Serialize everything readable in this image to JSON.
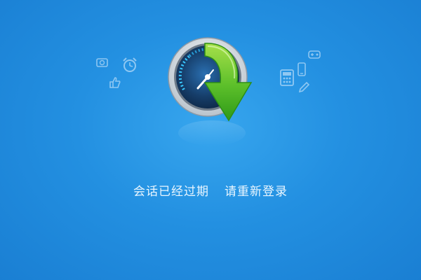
{
  "message": {
    "part1": "会话已经过期",
    "part2": "请重新登录"
  },
  "icons": {
    "app_logo": "speedometer-download-icon",
    "left_group": [
      "photo-icon",
      "alarm-clock-icon",
      "thumbs-up-icon"
    ],
    "right_group": [
      "gamepad-icon",
      "phone-icon",
      "calculator-icon",
      "pencil-icon"
    ]
  },
  "colors": {
    "background": "#2390e1",
    "accent_green": "#5bbf2a",
    "text": "#e9f6ff"
  }
}
